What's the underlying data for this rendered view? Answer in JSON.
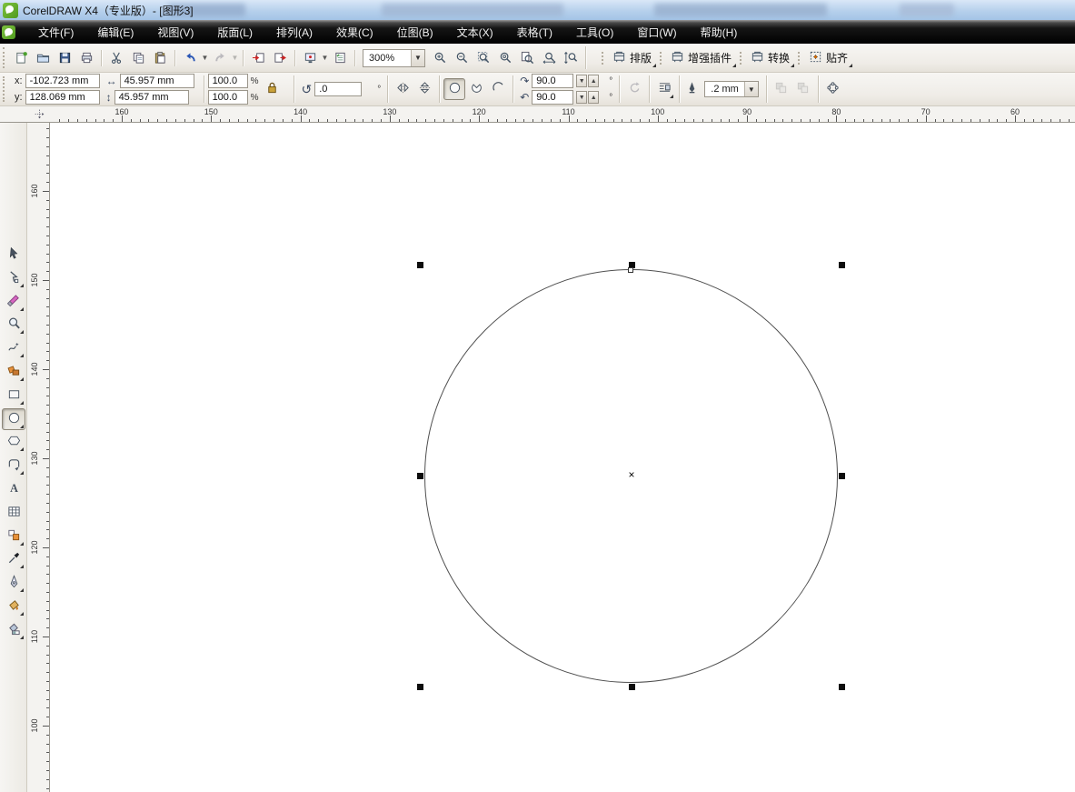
{
  "window": {
    "title": "CorelDRAW X4（专业版）- [图形3]"
  },
  "menu_bar": {
    "items": [
      {
        "name": "file",
        "label": "文件(F)"
      },
      {
        "name": "edit",
        "label": "编辑(E)"
      },
      {
        "name": "view",
        "label": "视图(V)"
      },
      {
        "name": "layout",
        "label": "版面(L)"
      },
      {
        "name": "arrange",
        "label": "排列(A)"
      },
      {
        "name": "effects",
        "label": "效果(C)"
      },
      {
        "name": "bitmaps",
        "label": "位图(B)"
      },
      {
        "name": "text",
        "label": "文本(X)"
      },
      {
        "name": "table",
        "label": "表格(T)"
      },
      {
        "name": "tools",
        "label": "工具(O)"
      },
      {
        "name": "window",
        "label": "窗口(W)"
      },
      {
        "name": "help",
        "label": "帮助(H)"
      }
    ]
  },
  "standard_toolbar": {
    "zoom_level": "300%",
    "groups": [
      [
        {
          "name": "new-button",
          "icon": "new-document"
        },
        {
          "name": "open-button",
          "icon": "open-folder"
        },
        {
          "name": "save-button",
          "icon": "save-disk"
        },
        {
          "name": "print-button",
          "icon": "print"
        }
      ],
      [
        {
          "name": "cut-button",
          "icon": "cut-scissors"
        },
        {
          "name": "copy-button",
          "icon": "copy-pages"
        },
        {
          "name": "paste-button",
          "icon": "paste-clipboard"
        }
      ],
      [
        {
          "name": "undo-button",
          "icon": "undo-arrow",
          "dropdown": true
        },
        {
          "name": "redo-button",
          "icon": "redo-arrow",
          "dropdown": true,
          "disabled": true
        }
      ],
      [
        {
          "name": "import-button",
          "icon": "import-file"
        },
        {
          "name": "export-button",
          "icon": "export-file"
        }
      ],
      [
        {
          "name": "app-launcher-button",
          "icon": "app-launcher",
          "dropdown": true
        },
        {
          "name": "welcome-screen-button",
          "icon": "welcome-screen"
        }
      ]
    ],
    "zoom_tools": [
      {
        "name": "zoom-in-button",
        "icon": "zoom-in"
      },
      {
        "name": "zoom-out-button",
        "icon": "zoom-out"
      },
      {
        "name": "zoom-selected-button",
        "icon": "zoom-selected"
      },
      {
        "name": "zoom-all-objects-button",
        "icon": "zoom-all"
      },
      {
        "name": "zoom-page-button",
        "icon": "zoom-page"
      },
      {
        "name": "zoom-page-width-button",
        "icon": "zoom-width"
      },
      {
        "name": "zoom-page-height-button",
        "icon": "zoom-height"
      }
    ],
    "plugin_buttons": [
      {
        "name": "paiban-button",
        "icon": "layout-press",
        "label": "排版"
      },
      {
        "name": "plugins-button",
        "icon": "layout-press",
        "label": "增强插件"
      },
      {
        "name": "convert-button",
        "icon": "layout-press",
        "label": "转换"
      },
      {
        "name": "snap-button",
        "icon": "snap-grid",
        "label": "贴齐"
      }
    ]
  },
  "property_bar": {
    "x_label": "x:",
    "x_value": "-102.723 mm",
    "y_label": "y:",
    "y_value": "128.069 mm",
    "width_value": "45.957 mm",
    "height_value": "45.957 mm",
    "scale_h": "100.0",
    "scale_v": "100.0",
    "percent_h": "%",
    "percent_v": "%",
    "rotation_value": ".0",
    "rotation_degree": "°",
    "start_angle": "90.0",
    "end_angle": "90.0",
    "start_degree": "°",
    "end_degree": "°",
    "outline_width": ".2 mm",
    "glyph_width": "↔",
    "glyph_height": "↕",
    "glyph_rotate": "↺",
    "glyph_cw": "↷",
    "glyph_ccw": "↶",
    "spin_down": "▼",
    "spin_up": "▲",
    "combo_arrow": "▼"
  },
  "rulers": {
    "h_labels": [
      "160",
      "150",
      "140",
      "130",
      "120",
      "110",
      "100",
      "90",
      "80",
      "70",
      "60"
    ],
    "v_labels": [
      "160",
      "150",
      "140",
      "130",
      "120",
      "110",
      "100"
    ]
  },
  "toolbox": {
    "tools": [
      {
        "name": "pick-tool",
        "icon": "pick",
        "flyout": false
      },
      {
        "name": "shape-tool",
        "icon": "shape",
        "flyout": true
      },
      {
        "name": "crop-tool",
        "icon": "crop",
        "flyout": true
      },
      {
        "name": "zoom-tool",
        "icon": "zoomt",
        "flyout": true
      },
      {
        "name": "freehand-tool",
        "icon": "freehand",
        "flyout": true
      },
      {
        "name": "smart-fill-tool",
        "icon": "smartfill",
        "flyout": true
      },
      {
        "name": "rectangle-tool",
        "icon": "rectangle",
        "flyout": true
      },
      {
        "name": "ellipse-tool",
        "icon": "ellipset",
        "flyout": true,
        "selected": true
      },
      {
        "name": "polygon-tool",
        "icon": "polygon",
        "flyout": true
      },
      {
        "name": "basic-shapes-tool",
        "icon": "basicshapes",
        "flyout": true
      },
      {
        "name": "text-tool",
        "icon": "textt",
        "flyout": false
      },
      {
        "name": "table-tool",
        "icon": "tablet",
        "flyout": false
      },
      {
        "name": "interactive-blend-tool",
        "icon": "blend",
        "flyout": true
      },
      {
        "name": "eyedropper-tool",
        "icon": "eyedropper",
        "flyout": true
      },
      {
        "name": "outline-pen-tool",
        "icon": "outlinepen",
        "flyout": true
      },
      {
        "name": "fill-tool",
        "icon": "fillbucket",
        "flyout": true
      },
      {
        "name": "interactive-fill-tool",
        "icon": "interfill",
        "flyout": true
      }
    ]
  },
  "canvas": {
    "center_marker": "×"
  }
}
